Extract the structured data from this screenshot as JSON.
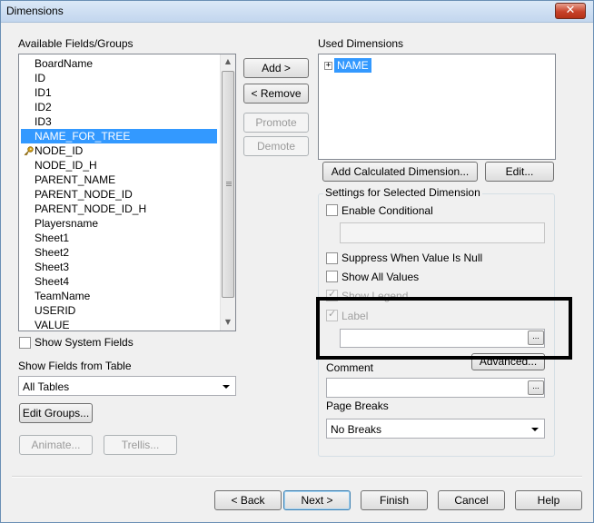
{
  "window": {
    "title": "Dimensions",
    "close_glyph": "✕"
  },
  "available": {
    "label": "Available Fields/Groups",
    "items": [
      "BoardName",
      "ID",
      "ID1",
      "ID2",
      "ID3",
      "NAME_FOR_TREE",
      "NODE_ID",
      "NODE_ID_H",
      "PARENT_NAME",
      "PARENT_NODE_ID",
      "PARENT_NODE_ID_H",
      "Playersname",
      "Sheet1",
      "Sheet2",
      "Sheet3",
      "Sheet4",
      "TeamName",
      "USERID",
      "VALUE"
    ],
    "selected_item": "NAME_FOR_TREE",
    "key_item": "NODE_ID",
    "key_icon": "key-icon",
    "show_system_fields_label": "Show System Fields",
    "show_system_fields_checked": false,
    "show_fields_from_table_label": "Show Fields from Table",
    "table_selected": "All Tables",
    "edit_groups_label": "Edit Groups...",
    "animate_label": "Animate...",
    "trellis_label": "Trellis..."
  },
  "middle_buttons": {
    "add": "Add >",
    "remove": "< Remove",
    "promote": "Promote",
    "demote": "Demote"
  },
  "used": {
    "label": "Used Dimensions",
    "tree": [
      {
        "expander": "+",
        "label": "NAME",
        "selected": true
      }
    ],
    "add_calculated_label": "Add Calculated Dimension...",
    "edit_label": "Edit..."
  },
  "settings": {
    "group_title": "Settings for Selected Dimension",
    "enable_conditional": {
      "label": "Enable Conditional",
      "checked": false
    },
    "conditional_value": "",
    "suppress_null": {
      "label": "Suppress When Value Is Null",
      "checked": false
    },
    "show_all_values": {
      "label": "Show All Values",
      "checked": false
    },
    "show_legend": {
      "label": "Show Legend",
      "checked": true,
      "disabled": true
    },
    "label_option": {
      "label": "Label",
      "checked": true,
      "disabled": true
    },
    "label_value": "",
    "ellipsis": "...",
    "advanced_label": "Advanced...",
    "comment_label": "Comment",
    "comment_value": "",
    "page_breaks_label": "Page Breaks",
    "page_breaks_selected": "No Breaks"
  },
  "footer": {
    "back": "< Back",
    "next": "Next >",
    "finish": "Finish",
    "cancel": "Cancel",
    "help": "Help"
  },
  "colors": {
    "selection": "#3399ff",
    "highlight_rect": "#000000"
  }
}
